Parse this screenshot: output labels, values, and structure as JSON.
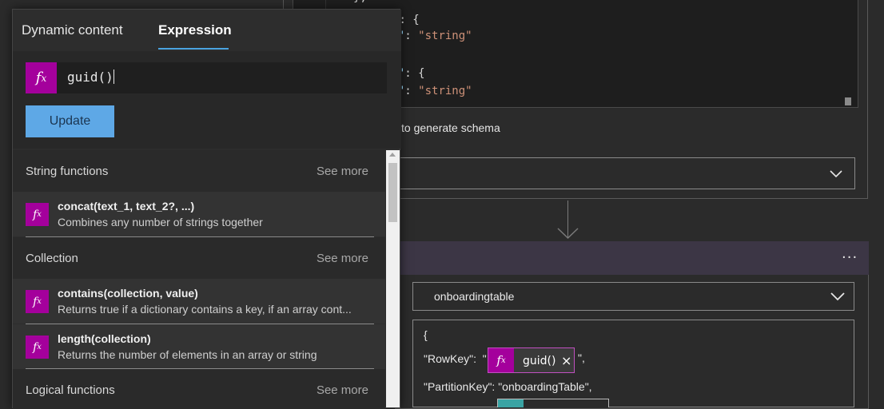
{
  "panel": {
    "tabs": [
      {
        "label": "Dynamic content"
      },
      {
        "label": "Expression"
      }
    ],
    "expression": {
      "value": "guid()"
    },
    "update_label": "Update",
    "sections": [
      {
        "title": "String functions",
        "see_more": "See more",
        "items": [
          {
            "name": "concat(text_1, text_2?, ...)",
            "desc": "Combines any number of strings together"
          }
        ]
      },
      {
        "title": "Collection",
        "see_more": "See more",
        "items": [
          {
            "name": "contains(collection, value)",
            "desc": "Returns true if a dictionary contains a key, if an array cont..."
          },
          {
            "name": "length(collection)",
            "desc": "Returns the number of elements in an array or string"
          }
        ]
      },
      {
        "title": "Logical functions",
        "see_more": "See more"
      }
    ]
  },
  "canvas": {
    "code_lines": [
      {
        "text1": "},",
        "key": "",
        "text2": "",
        "str": ""
      },
      {
        "text1": "",
        "key": "\"",
        "text2": ": {",
        "str": ""
      },
      {
        "text1": "",
        "key": "pe\"",
        "text2": ": ",
        "str": "\"string\""
      },
      {
        "text1": "",
        "key": "on\"",
        "text2": ": {",
        "str": ""
      },
      {
        "text1": "",
        "key": "pe\"",
        "text2": ": ",
        "str": "\"string\""
      }
    ],
    "generate_schema_text": "to generate schema",
    "table_name": "onboardingtable",
    "more_label": "···",
    "entity": {
      "open_brace": "{",
      "rowkey_prefix": "\"RowKey\":  \"",
      "token_label": "guid()",
      "token_close": "×",
      "rowkey_suffix": "\",",
      "partition_line": "\"PartitionKey\": \"onboardingTable\","
    }
  },
  "colors": {
    "accent": "#4aa3e0",
    "fx_badge": "#a4009c",
    "update_button": "#5ea8e6"
  },
  "icons": [
    "fx-icon",
    "chevron-down-icon",
    "close-icon",
    "arrow-down-icon",
    "more-icon"
  ]
}
